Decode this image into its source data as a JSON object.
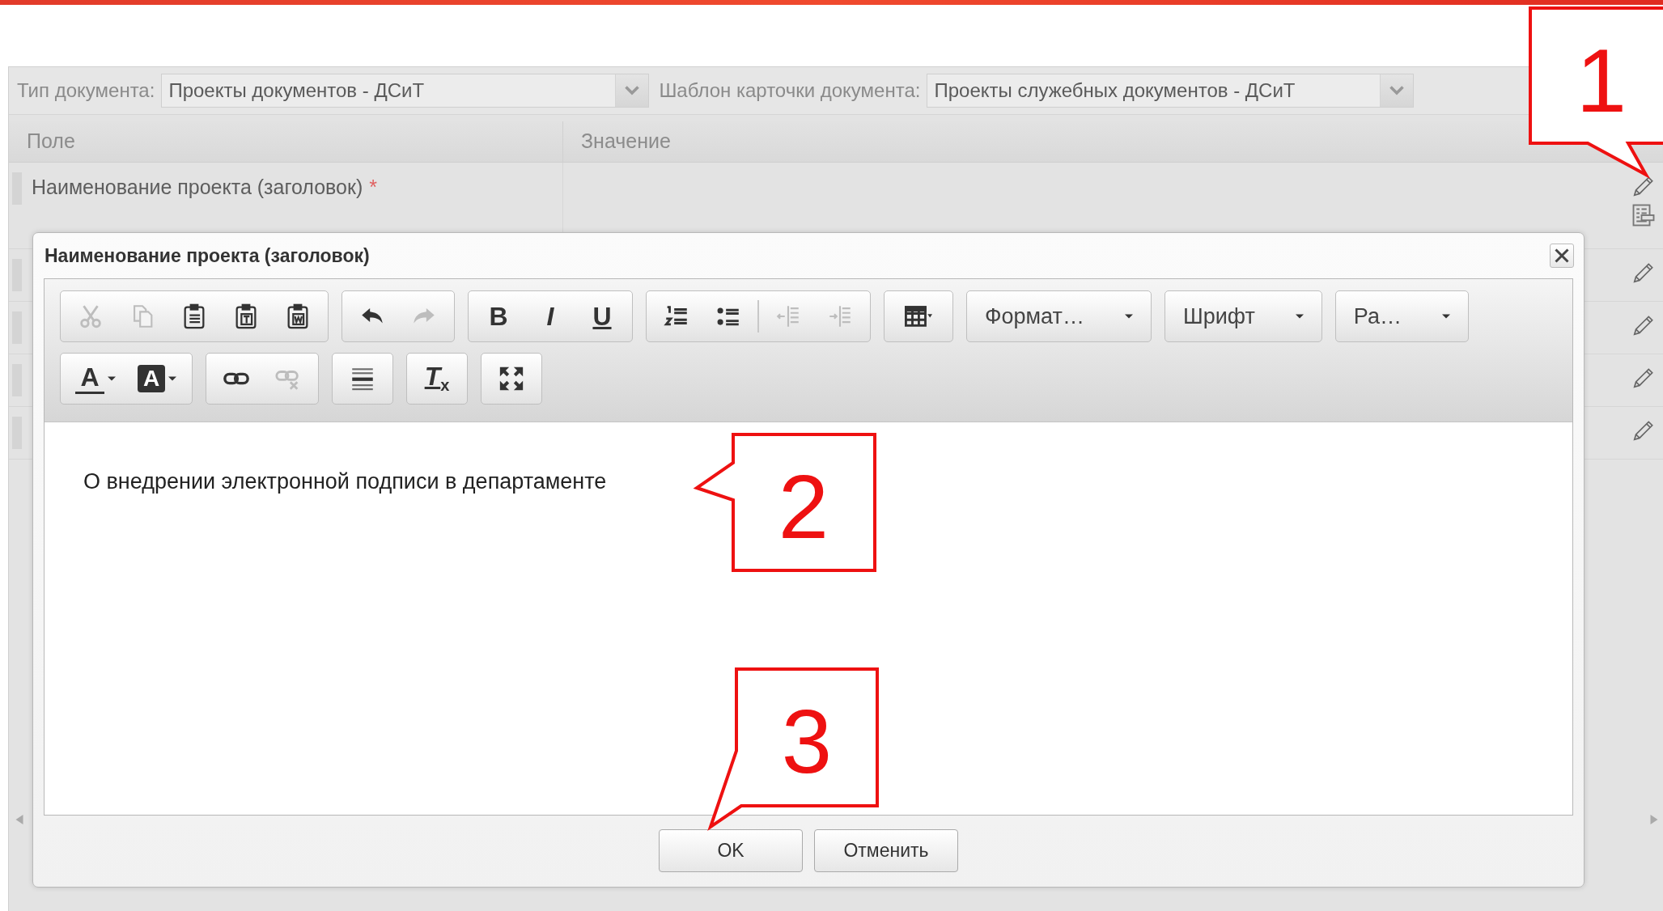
{
  "top_bar": {
    "document_type": {
      "label": "Тип документа:",
      "value": "Проекты документов - ДСиТ"
    },
    "card_template": {
      "label": "Шаблон карточки документа:",
      "value": "Проекты служебных документов - ДСиТ"
    }
  },
  "grid": {
    "columns": [
      "Поле",
      "Значение"
    ],
    "rows": [
      {
        "field": "Наименование проекта (заголовок)",
        "required_mark": "*",
        "actions": [
          {
            "kind": "edit"
          },
          {
            "kind": "details"
          }
        ]
      },
      {
        "actions": [
          {
            "kind": "edit"
          }
        ]
      },
      {
        "actions": [
          {
            "kind": "edit"
          }
        ]
      },
      {
        "actions": [
          {
            "kind": "edit"
          }
        ]
      },
      {
        "actions": [
          {
            "kind": "edit"
          }
        ]
      }
    ]
  },
  "dialog": {
    "title": "Наименование проекта (заголовок)",
    "toolbar_rows": [
      {
        "groups": [
          {
            "items": [
              {
                "kind": "cut",
                "disabled": true
              },
              {
                "kind": "copy",
                "disabled": true
              },
              {
                "kind": "paste",
                "disabled": false
              },
              {
                "kind": "paste-text",
                "disabled": false
              },
              {
                "kind": "paste-word",
                "disabled": false
              }
            ]
          },
          {
            "items": [
              {
                "kind": "undo",
                "disabled": false
              },
              {
                "kind": "redo",
                "disabled": true
              }
            ]
          },
          {
            "items": [
              {
                "kind": "bold",
                "label": "B",
                "disabled": false
              },
              {
                "kind": "italic",
                "label": "I",
                "disabled": false
              },
              {
                "kind": "underline",
                "label": "U",
                "disabled": false
              }
            ]
          },
          {
            "items": [
              {
                "kind": "numbered-list",
                "disabled": false
              },
              {
                "kind": "bulleted-list",
                "disabled": false
              },
              {
                "kind": "separator"
              },
              {
                "kind": "outdent",
                "disabled": true
              },
              {
                "kind": "indent",
                "disabled": true
              }
            ]
          },
          {
            "items": [
              {
                "kind": "table",
                "disabled": false
              }
            ]
          },
          {
            "kind": "combo",
            "label": "Формат…"
          },
          {
            "kind": "combo",
            "label": "Шрифт"
          },
          {
            "kind": "combo",
            "label": "Ра…"
          }
        ]
      },
      {
        "groups": [
          {
            "items": [
              {
                "kind": "text-color",
                "label": "A",
                "disabled": false
              },
              {
                "kind": "background-color",
                "label": "A",
                "disabled": false
              }
            ]
          },
          {
            "items": [
              {
                "kind": "link",
                "disabled": false
              },
              {
                "kind": "unlink",
                "disabled": true
              }
            ]
          },
          {
            "items": [
              {
                "kind": "horizontal-rule",
                "disabled": false
              }
            ]
          },
          {
            "items": [
              {
                "kind": "remove-format",
                "label": "T$_{x}$",
                "disabled": false
              }
            ]
          },
          {
            "items": [
              {
                "kind": "maximize",
                "disabled": false
              }
            ]
          }
        ]
      }
    ],
    "content": "О внедрении электронной подписи в департаменте",
    "buttons": [
      {
        "label": "OK"
      },
      {
        "label": "Отменить"
      }
    ]
  },
  "annotations": [
    {
      "number": "1"
    },
    {
      "number": "2"
    },
    {
      "number": "3"
    }
  ]
}
